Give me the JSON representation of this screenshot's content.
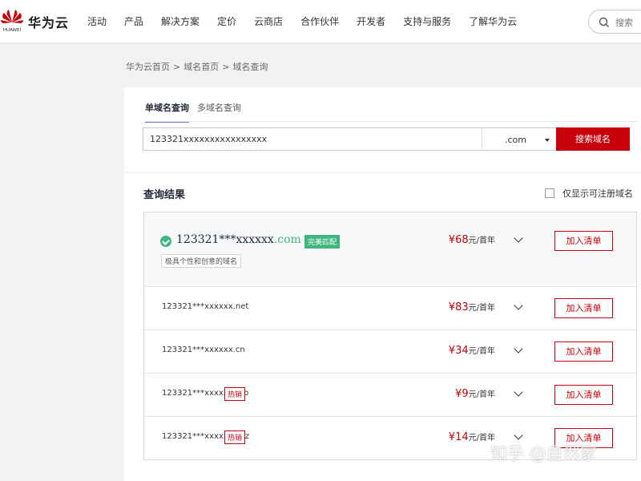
{
  "header": {
    "brand_name": "华为云",
    "logo_caption": "HUAWEI",
    "nav": [
      "活动",
      "产品",
      "解决方案",
      "定价",
      "云商店",
      "合作伙伴",
      "开发者",
      "支持与服务",
      "了解华为云"
    ],
    "search_placeholder": "搜索"
  },
  "breadcrumb": [
    "华为云首页",
    "域名首页",
    "域名查询"
  ],
  "breadcrumb_sep": ">",
  "query": {
    "tabs": [
      "单域名查询",
      "多域名查询"
    ],
    "input_value": "123321xxxxxxxxxxxxxxxx",
    "suffix": ".com",
    "search_button": "搜索域名"
  },
  "results": {
    "title": "查询结果",
    "filter_label": "仅显示可注册域名",
    "featured": {
      "name": "123321***xxxxxx",
      "tld": ".com",
      "badge": "完美匹配",
      "tag": "极具个性和创意的域名",
      "price": "¥68",
      "unit": "元/首年",
      "button": "加入清单"
    },
    "rows": [
      {
        "domain": "123321***xxxxxx.net",
        "hot": "",
        "price": "¥83",
        "unit": "元/首年",
        "button": "加入清单"
      },
      {
        "domain": "123321***xxxxxx.cn",
        "hot": "",
        "price": "¥34",
        "unit": "元/首年",
        "button": "加入清单"
      },
      {
        "domain": "123321***xxxxxx.top",
        "hot": "热销",
        "price": "¥9",
        "unit": "元/首年",
        "button": "加入清单"
      },
      {
        "domain": "123321***xxxxxx.xyz",
        "hot": "热销",
        "price": "¥14",
        "unit": "元/首年",
        "button": "加入清单"
      }
    ]
  },
  "watermark": "知乎 @自然家",
  "colors": {
    "brand_red": "#c7000b",
    "match_green": "#3fb57f",
    "tab_underline": "#5e7ce0"
  },
  "icons": [
    "huawei-logo-icon",
    "search-icon",
    "check-circle-icon",
    "chevron-down-icon",
    "caret-down-icon",
    "checkbox-icon"
  ]
}
